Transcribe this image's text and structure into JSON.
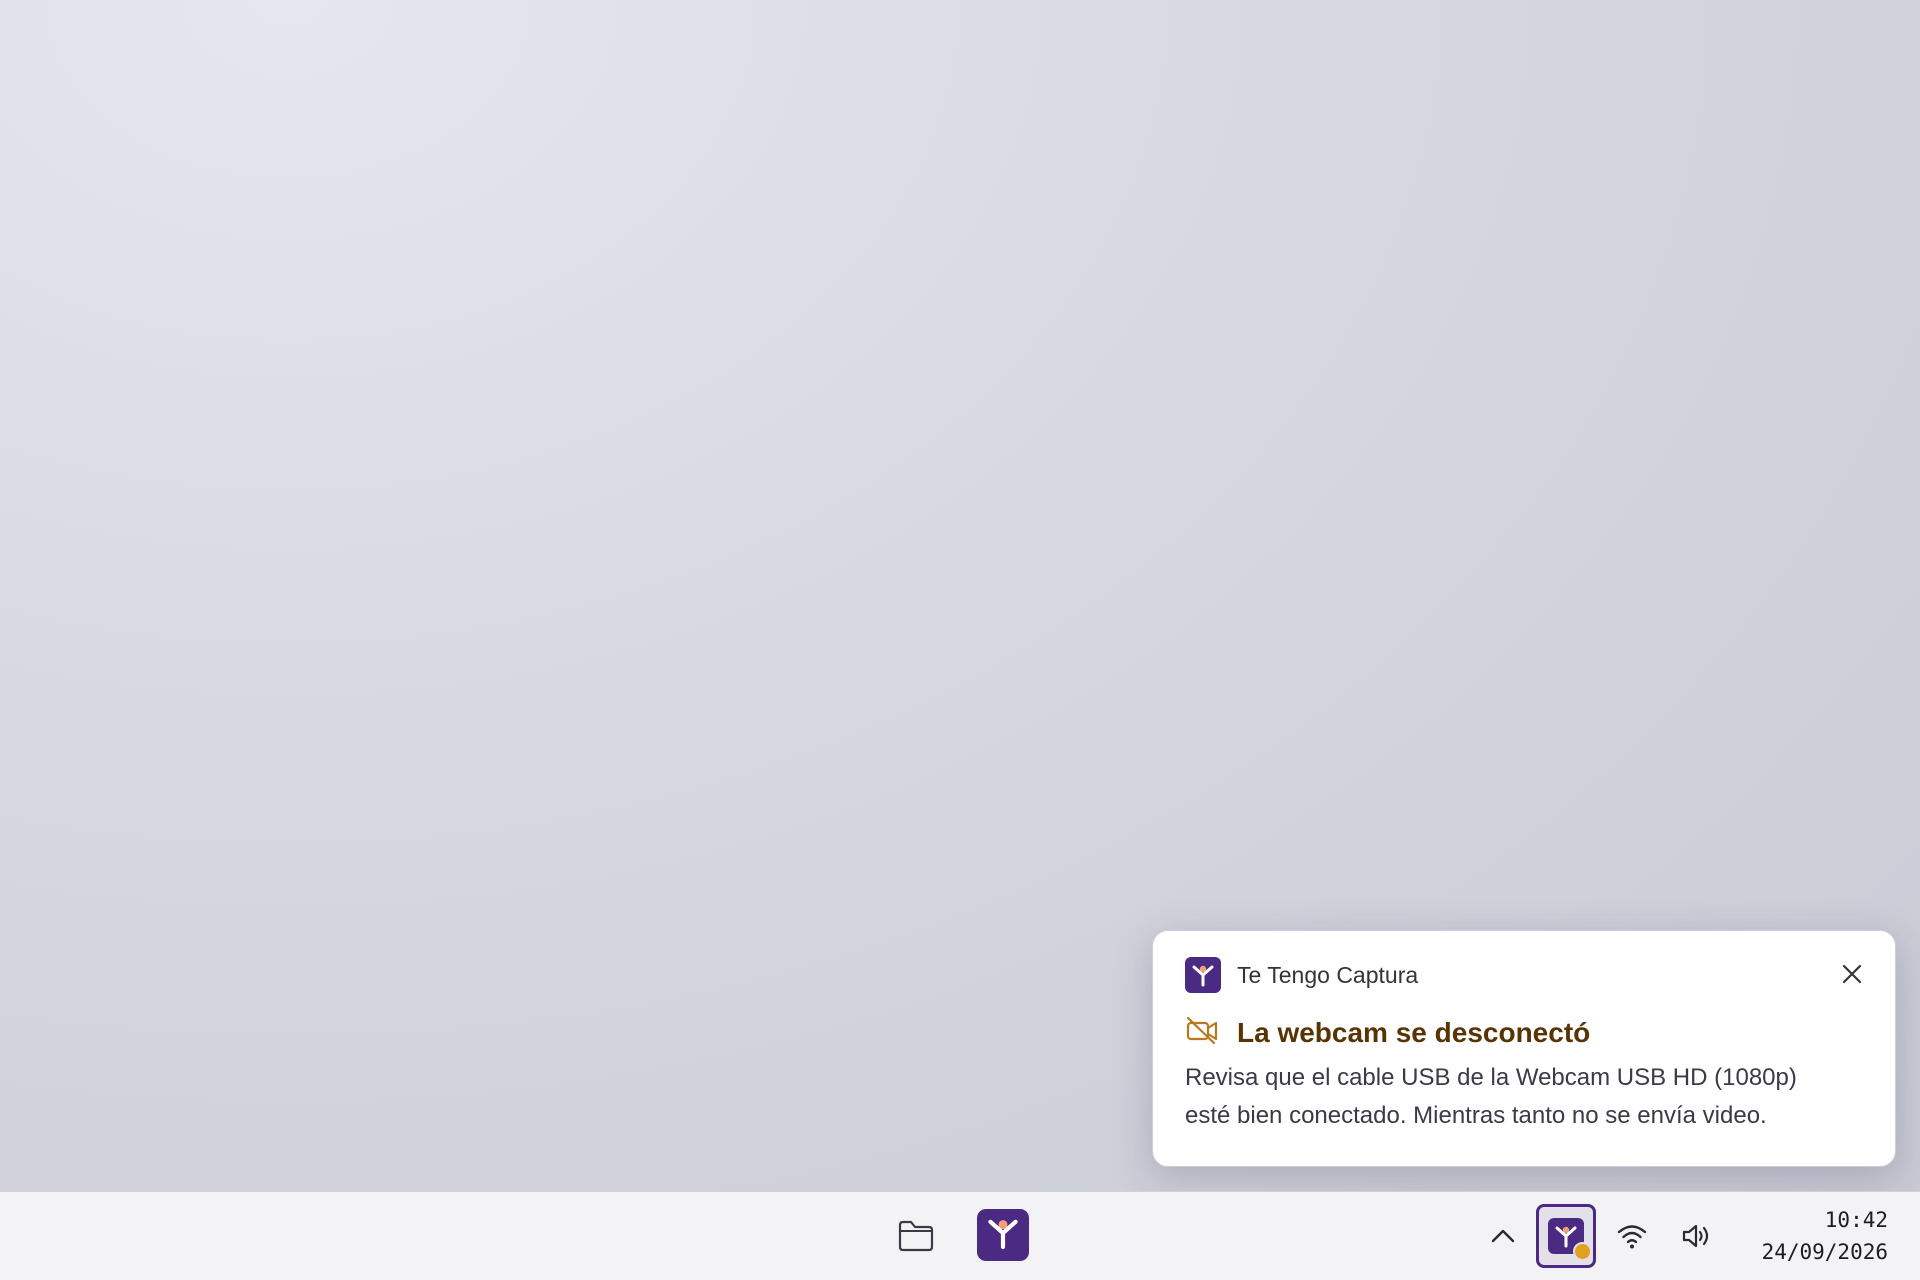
{
  "taskbar": {
    "pinned": [
      {
        "name": "File Explorer",
        "icon": "folder-icon"
      },
      {
        "name": "Te Tengo Captura",
        "icon": "te-tengo-captura-app-icon"
      }
    ],
    "tray": {
      "overflow_icon": "chevron-up-icon",
      "app_icon": "te-tengo-captura-tray-icon",
      "app_status_color": "#e0a020",
      "wifi_icon": "wifi-icon",
      "volume_icon": "volume-icon"
    },
    "clock": {
      "time": "10:42",
      "date": "24/09/2026"
    }
  },
  "notification": {
    "app_name": "Te Tengo Captura",
    "title": "La webcam se desconectó",
    "title_icon": "camera-off-icon",
    "body_line1": "Revisa que el cable USB de la Webcam USB HD (1080p)",
    "body_line2": "esté bien conectado. Mientras tanto no se envía video.",
    "close_icon": "close-icon"
  },
  "colors": {
    "brand": "#4a2a82",
    "warning_title": "#5a3304",
    "warning_icon": "#b8781c",
    "status_dot": "#e0a020"
  }
}
